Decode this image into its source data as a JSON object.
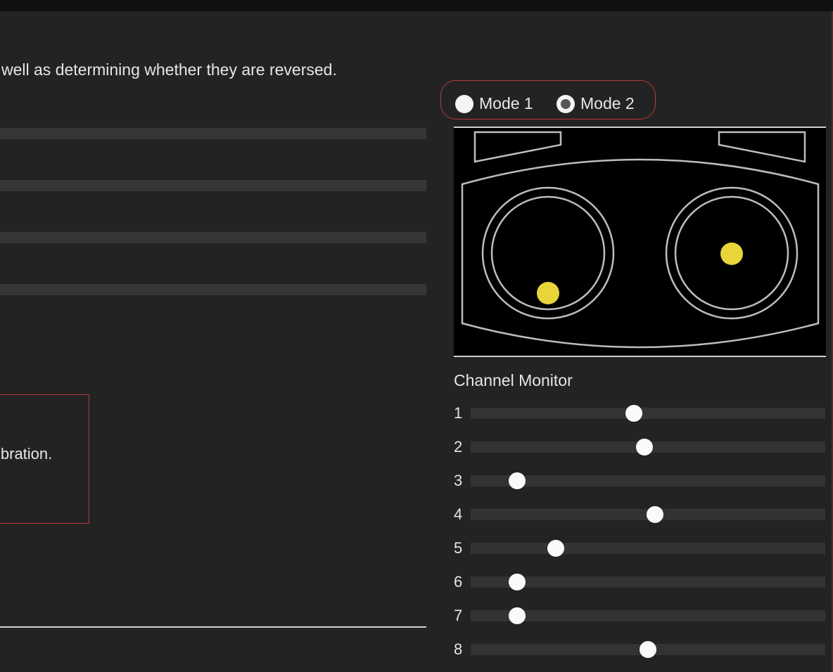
{
  "intro_text": "well as determining whether they are reversed.",
  "warning_text": "ibration.",
  "mode_selector": {
    "options": [
      {
        "label": "Mode 1",
        "selected": false
      },
      {
        "label": "Mode 2",
        "selected": true
      }
    ]
  },
  "stick_colors": {
    "outline": "#bdbdbd",
    "dot": "#e9d43a",
    "background": "#000000"
  },
  "channel_monitor": {
    "title": "Channel Monitor",
    "channels": [
      {
        "label": "1",
        "value": 0.46
      },
      {
        "label": "2",
        "value": 0.49
      },
      {
        "label": "3",
        "value": 0.13
      },
      {
        "label": "4",
        "value": 0.52
      },
      {
        "label": "5",
        "value": 0.24
      },
      {
        "label": "6",
        "value": 0.13
      },
      {
        "label": "7",
        "value": 0.13
      },
      {
        "label": "8",
        "value": 0.5
      }
    ]
  },
  "accent_color": "#b8393c"
}
